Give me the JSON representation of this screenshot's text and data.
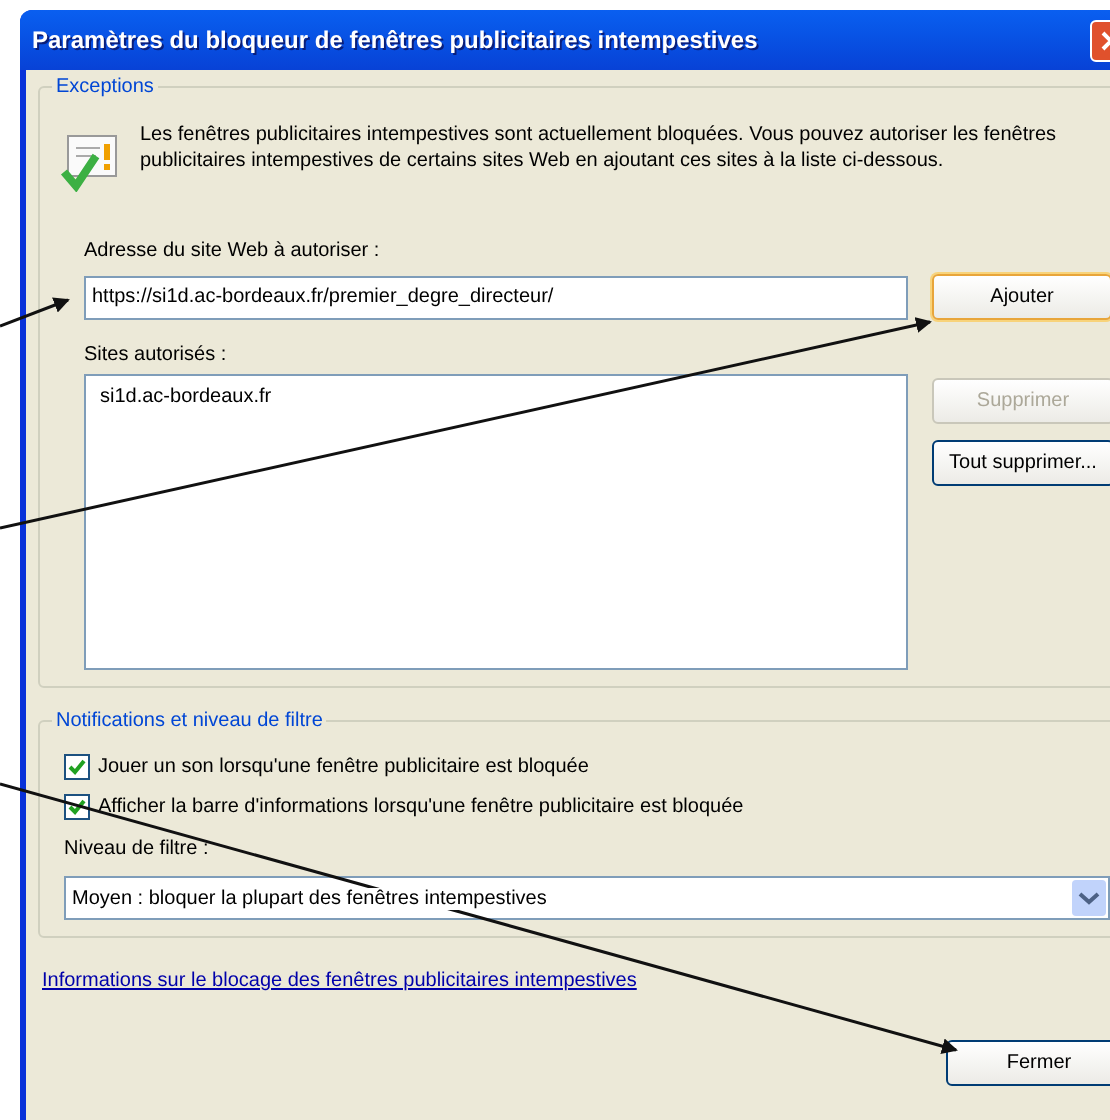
{
  "window": {
    "title": "Paramètres du bloqueur de fenêtres publicitaires intempestives"
  },
  "exceptions": {
    "legend": "Exceptions",
    "description": "Les fenêtres publicitaires intempestives sont actuellement bloquées.  Vous pouvez autoriser les fenêtres publicitaires intempestives de certains sites Web en ajoutant ces sites à la liste ci-dessous.",
    "address_label": "Adresse du site Web à autoriser :",
    "address_value": "https://si1d.ac-bordeaux.fr/premier_degre_directeur/",
    "add_button": {
      "label": "Ajouter",
      "default": true,
      "disabled": false
    },
    "sites_label": "Sites autorisés :",
    "sites": [
      {
        "label": "si1d.ac-bordeaux.fr",
        "selected": false
      }
    ],
    "side_buttons": [
      {
        "label": "Supprimer",
        "disabled": true,
        "default": false
      },
      {
        "label": "Tout supprimer...",
        "disabled": false,
        "default": false
      }
    ]
  },
  "notifications": {
    "legend": "Notifications et niveau de filtre",
    "options": [
      {
        "label": "Jouer un son lorsqu'une fenêtre publicitaire est bloquée",
        "checked": true
      },
      {
        "label": "Afficher la barre d'informations lorsqu'une fenêtre publicitaire est bloquée",
        "checked": true
      }
    ],
    "filter_label": "Niveau de filtre :",
    "filter_value": "Moyen : bloquer la plupart des fenêtres intempestives"
  },
  "link": "Informations sur le blocage des fenêtres publicitaires intempestives",
  "close_button": {
    "label": "Fermer",
    "default": false,
    "disabled": false
  }
}
